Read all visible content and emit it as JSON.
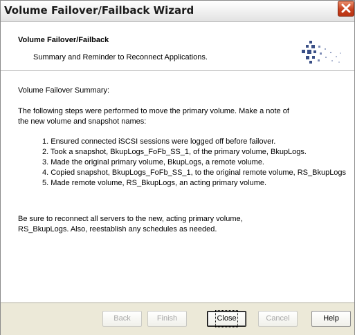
{
  "window": {
    "title": "Volume Failover/Failback Wizard",
    "close_icon": "close-icon"
  },
  "header": {
    "title": "Volume Failover/Failback",
    "subtitle": "Summary and Reminder to Reconnect Applications.",
    "logo_icon": "dotted-diamond-logo"
  },
  "content": {
    "summary_heading": "Volume Failover Summary:",
    "intro_line1": "The following steps were performed to move the primary volume. Make a note of",
    "intro_line2": "the new volume and snapshot names:",
    "steps": [
      "1. Ensured connected iSCSI sessions were logged off before failover.",
      "2. Took a snapshot, BkupLogs_FoFb_SS_1, of the primary volume, BkupLogs.",
      "3. Made the original primary volume, BkupLogs, a remote volume.",
      "4. Copied snapshot, BkupLogs_FoFb_SS_1, to the original remote volume, RS_BkupLogs",
      "5. Made remote volume, RS_BkupLogs, an acting primary volume."
    ],
    "reminder_line1": "Be sure to reconnect all servers to the new, acting primary volume,",
    "reminder_line2": "RS_BkupLogs. Also, reestablish any schedules as needed."
  },
  "footer": {
    "back_label": "Back",
    "finish_label": "Finish",
    "close_label": "Close",
    "cancel_label": "Cancel",
    "help_label": "Help"
  },
  "colors": {
    "titlebar_close": "#c8421f",
    "logo": "#3a4f86",
    "window_face": "#ece9d8"
  }
}
